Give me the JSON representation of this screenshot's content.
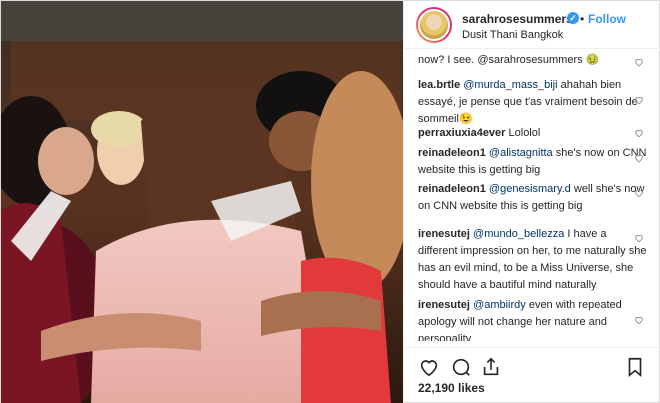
{
  "header": {
    "username": "sarahrosesummers",
    "follow_label": "Follow",
    "location": "Dusit Thani Bangkok"
  },
  "comments": [
    {
      "user": "",
      "mention": "",
      "text_before": "",
      "text": "now? I see. @sarahrosesummers 🤢"
    },
    {
      "user": "lea.brtle",
      "mention": "@murda_mass_biji",
      "text": " ahahah bien essayé, je pense que t'as vraiment besoin de sommeil😉"
    },
    {
      "user": "perraxiuxia4ever",
      "mention": "",
      "text": " Lololol"
    },
    {
      "user": "reinadeleon1",
      "mention": "@alistagnitta",
      "text": " she's now on CNN website this is getting big"
    },
    {
      "user": "reinadeleon1",
      "mention": "@genesismary.d",
      "text": " well she's now on CNN website this is getting big"
    },
    {
      "user": "irenesutej",
      "mention": "@mundo_bellezza",
      "text": " I have a different impression on her, to me naturally she has an evil mind, to be a Miss Universe, she should have a bautiful mind naturally"
    },
    {
      "user": "irenesutej",
      "mention": "@ambiirdy",
      "text": " even with repeated apology will not change her nature and personality"
    }
  ],
  "likes": "22,190 likes",
  "icons": {
    "like": "heart-icon",
    "comment": "comment-icon",
    "share": "share-icon",
    "save": "bookmark-icon",
    "verified": "verified-badge-icon"
  },
  "colors": {
    "accent": "#3897f0",
    "mention": "#003569",
    "text": "#262626"
  }
}
